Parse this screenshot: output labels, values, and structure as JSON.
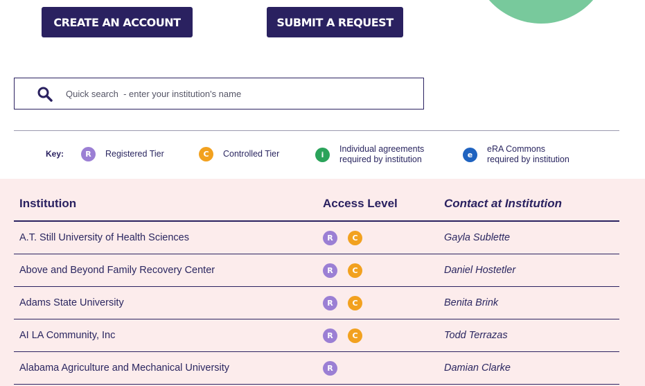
{
  "buttons": {
    "create_account": "CREATE AN ACCOUNT",
    "submit_request": "SUBMIT A REQUEST"
  },
  "search": {
    "placeholder": "Quick search  - enter your institution's name",
    "value": ""
  },
  "key": {
    "label": "Key:",
    "items": [
      {
        "letter": "R",
        "text1": "Registered Tier",
        "text2": "",
        "icon": "registered-tier-badge",
        "color": "#9b7fd4"
      },
      {
        "letter": "C",
        "text1": "Controlled Tier",
        "text2": "",
        "icon": "controlled-tier-badge",
        "color": "#f2a11f"
      },
      {
        "letter": "i",
        "text1": "Individual agreements",
        "text2": "required by institution",
        "icon": "individual-agreements-badge",
        "color": "#2aa35a"
      },
      {
        "letter": "e",
        "text1": "eRA Commons",
        "text2": "required by institution",
        "icon": "era-commons-badge",
        "color": "#1f63c0"
      }
    ]
  },
  "table": {
    "headers": {
      "institution": "Institution",
      "access": "Access Level",
      "contact": "Contact at Institution"
    },
    "rows": [
      {
        "institution": "A.T. Still University of Health Sciences",
        "access": [
          "R",
          "C"
        ],
        "contact": "Gayla Sublette"
      },
      {
        "institution": "Above and Beyond Family Recovery Center",
        "access": [
          "R",
          "C"
        ],
        "contact": "Daniel Hostetler"
      },
      {
        "institution": "Adams State University",
        "access": [
          "R",
          "C"
        ],
        "contact": "Benita Brink"
      },
      {
        "institution": "AI LA Community, Inc",
        "access": [
          "R",
          "C"
        ],
        "contact": "Todd Terrazas"
      },
      {
        "institution": "Alabama Agriculture and Mechanical University",
        "access": [
          "R"
        ],
        "contact": "Damian Clarke"
      }
    ]
  },
  "colors": {
    "navy": "#2a2160",
    "table_background": "#fcecec",
    "decor_circle": "#78c99c"
  }
}
